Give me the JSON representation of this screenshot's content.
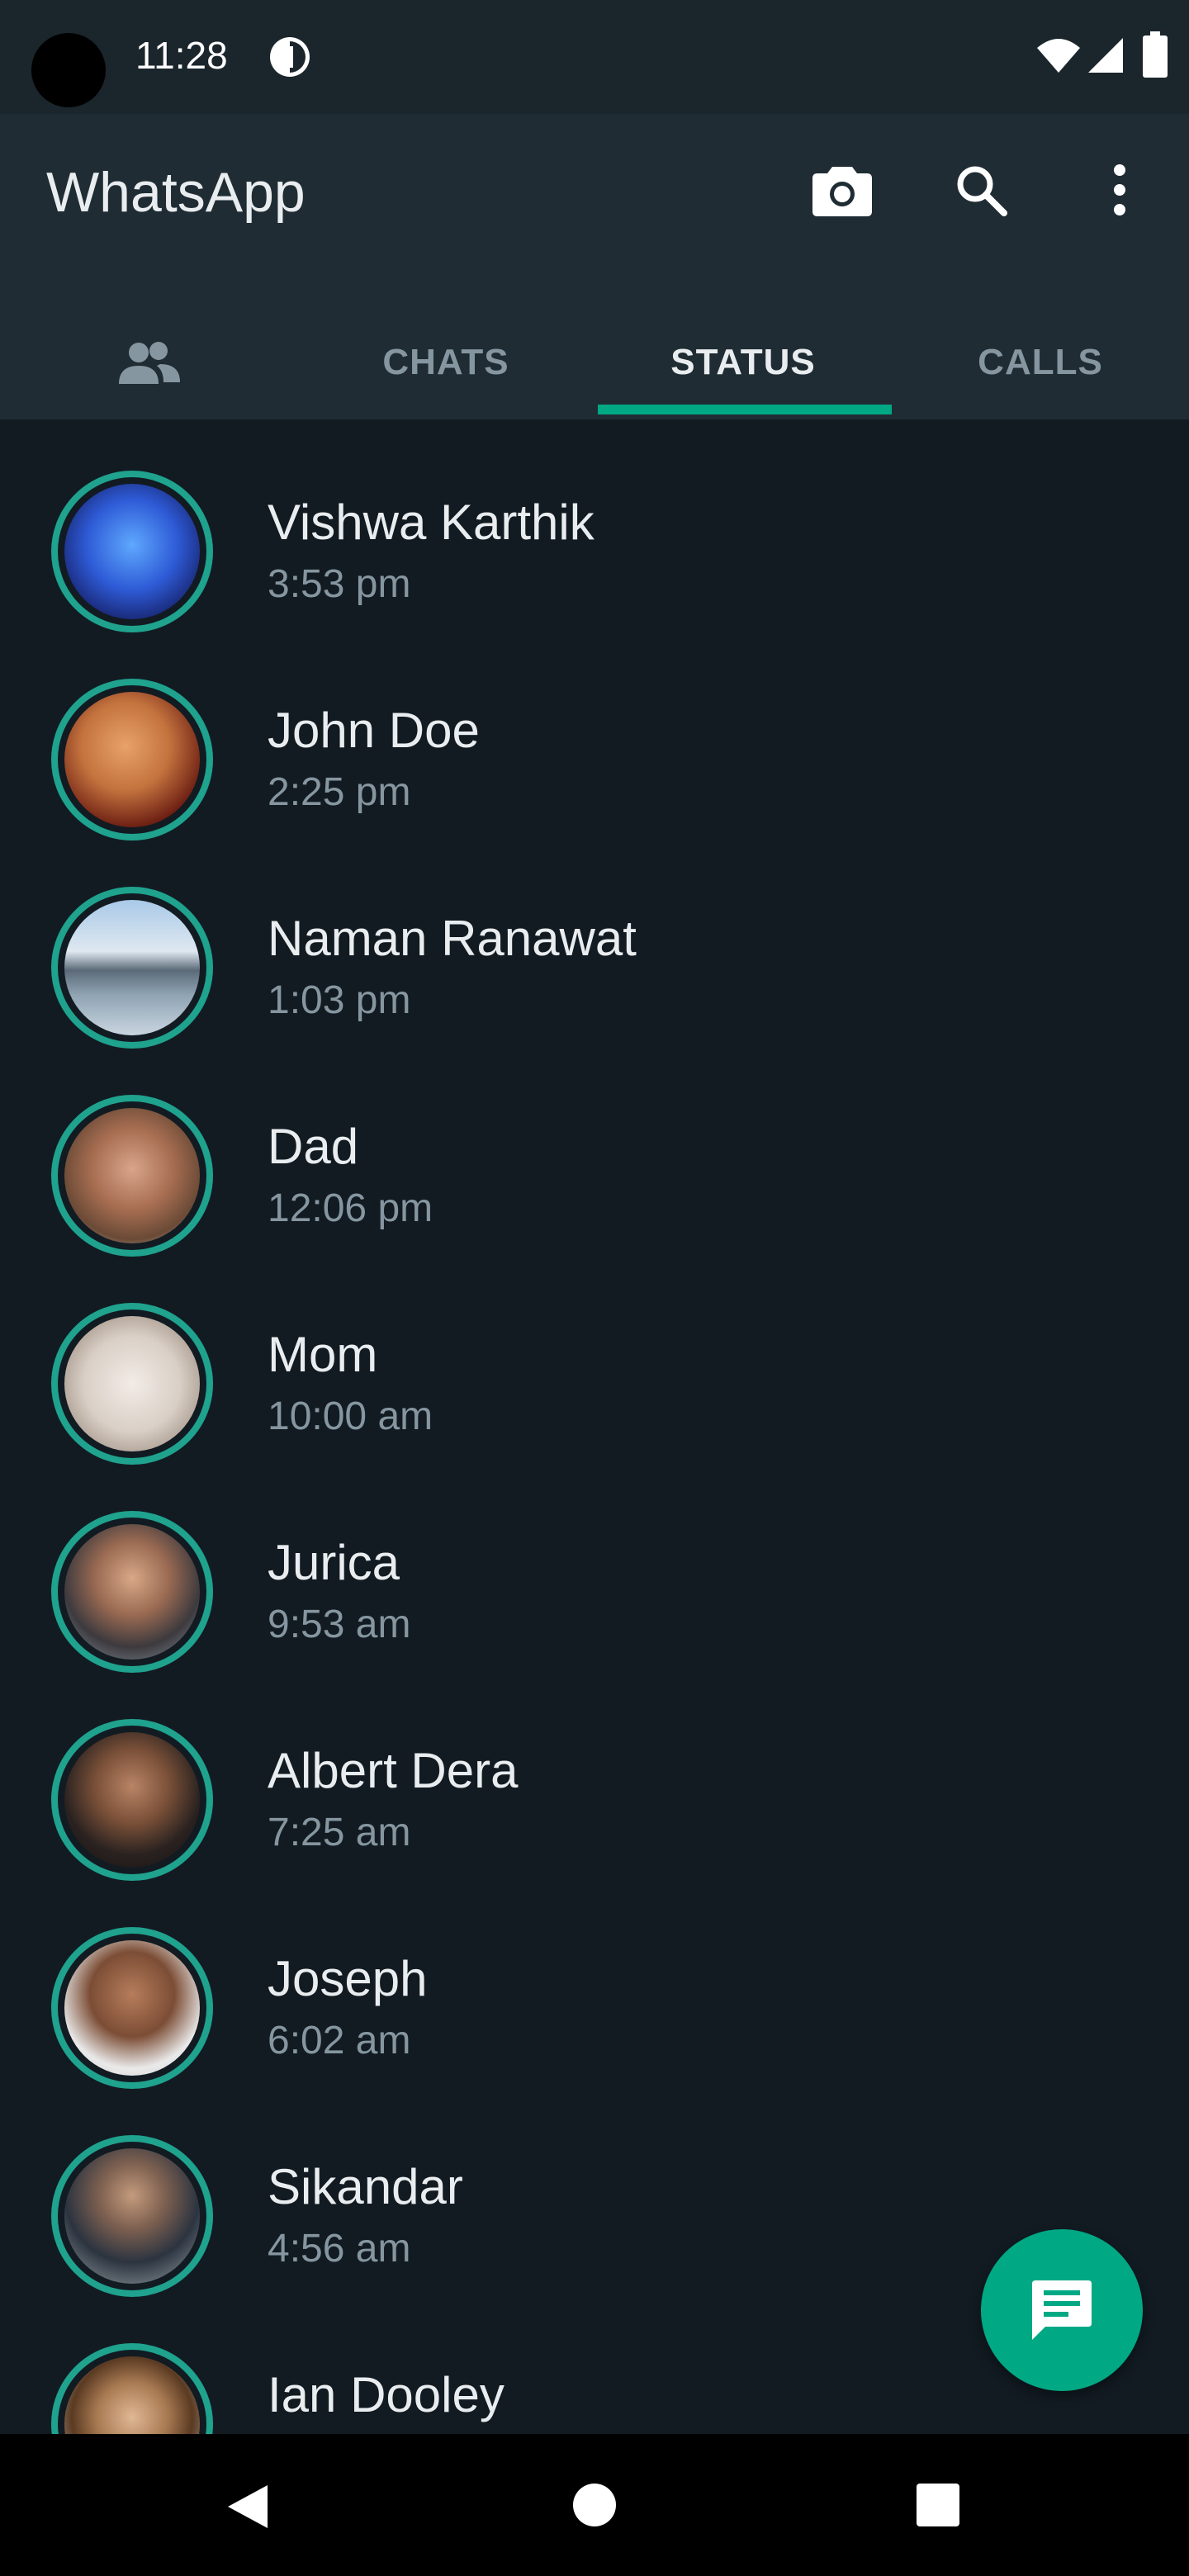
{
  "status_bar": {
    "time": "11:28"
  },
  "app_bar": {
    "title": "WhatsApp"
  },
  "tabs": [
    {
      "label": ""
    },
    {
      "label": "CHATS"
    },
    {
      "label": "STATUS",
      "active": true
    },
    {
      "label": "CALLS"
    }
  ],
  "statuses": [
    {
      "name": "Vishwa Karthik",
      "time": "3:53 pm"
    },
    {
      "name": "John Doe",
      "time": "2:25 pm"
    },
    {
      "name": "Naman Ranawat",
      "time": "1:03 pm"
    },
    {
      "name": "Dad",
      "time": "12:06 pm"
    },
    {
      "name": "Mom",
      "time": "10:00 am"
    },
    {
      "name": "Jurica",
      "time": "9:53 am"
    },
    {
      "name": "Albert Dera",
      "time": "7:25 am"
    },
    {
      "name": "Joseph",
      "time": "6:02 am"
    },
    {
      "name": "Sikandar",
      "time": "4:56 am"
    },
    {
      "name": "Ian Dooley",
      "time": ""
    }
  ],
  "colors": {
    "background": "#121b22",
    "app_bar": "#1f2c34",
    "accent": "#00a884",
    "status_ring": "#1fa28e",
    "primary_text": "#e9edef",
    "secondary_text": "#8696a0"
  },
  "icons": {
    "people_tab": "community-icon",
    "camera": "camera-icon",
    "search": "search-icon",
    "menu": "more-vert-icon",
    "fab": "message-icon"
  }
}
